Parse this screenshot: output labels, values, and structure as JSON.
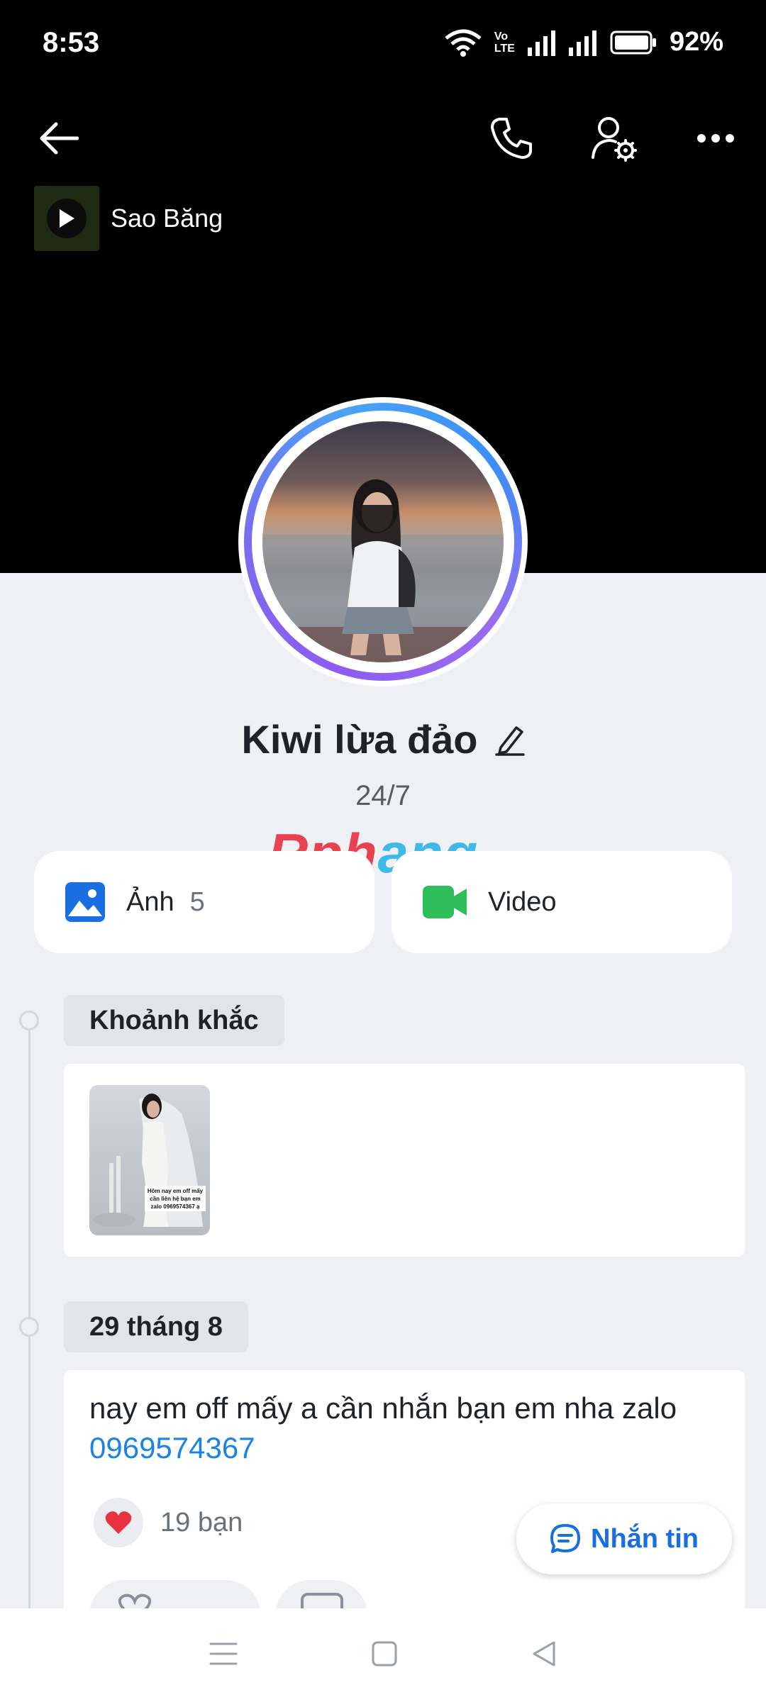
{
  "status_bar": {
    "time": "8:53",
    "battery": "92%",
    "lte_top": "Vo",
    "lte_bottom": "LTE"
  },
  "header": {
    "back_icon": "arrow-left-icon",
    "call_icon": "phone-icon",
    "settings_icon": "user-gear-icon",
    "more_icon": "more-horizontal-icon"
  },
  "music": {
    "title": "Sao Băng"
  },
  "profile": {
    "name": "Kiwi lừa đảo",
    "status": "24/7"
  },
  "watermark": {
    "part1": "Rph",
    "part2": "ang"
  },
  "media": {
    "photos_label": "Ảnh",
    "photos_count": "5",
    "videos_label": "Video"
  },
  "timeline": {
    "moments_label": "Khoảnh khắc",
    "moment_caption_lines": [
      "Hôm nay em off mấy",
      "cần liên hệ bạn em",
      "zalo 0969574367 ạ"
    ],
    "date_label": "29 tháng 8",
    "post_text": "nay em off mấy a cần nhắn bạn em nha zalo",
    "post_link": "0969574367",
    "reaction_count": "19 bạn"
  },
  "chat_button": {
    "label": "Nhắn tin"
  },
  "colors": {
    "accent": "#1a6fe0",
    "link": "#1a84e6",
    "photos_icon": "#1a6fe0",
    "video_icon": "#2fbf5a",
    "heart": "#e8323f"
  }
}
